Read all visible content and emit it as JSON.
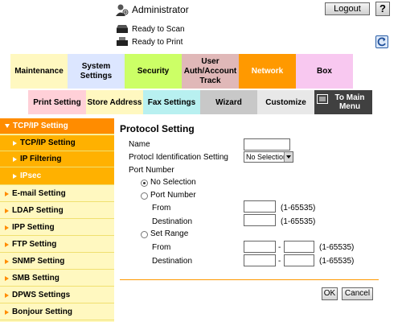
{
  "header": {
    "admin_label": "Administrator",
    "logout_label": "Logout",
    "help_label": "?",
    "status_scan": "Ready to Scan",
    "status_print": "Ready to Print"
  },
  "tabs_top": [
    {
      "label": "Maintenance",
      "bg": "#fff8c0"
    },
    {
      "label": "System Settings",
      "bg": "#dce6ff"
    },
    {
      "label": "Security",
      "bg": "#ccff66"
    },
    {
      "label": "User Auth/Account Track",
      "bg": "#e0b8b8"
    },
    {
      "label": "Network",
      "bg": "#ff9900",
      "active": true
    },
    {
      "label": "Box",
      "bg": "#f8c8f0"
    }
  ],
  "tabs_second": [
    {
      "label": "Print Setting",
      "bg": "#ffd0d8"
    },
    {
      "label": "Store Address",
      "bg": "#fff8c0"
    },
    {
      "label": "Fax Settings",
      "bg": "#b8f0f0"
    },
    {
      "label": "Wizard",
      "bg": "#c8c8c8"
    },
    {
      "label": "Customize",
      "bg": "#e8e8e8"
    },
    {
      "label": "To Main Menu",
      "bg": "#404040"
    }
  ],
  "sidebar": {
    "items": [
      {
        "label": "TCP/IP Setting"
      },
      {
        "label": "TCP/IP Setting"
      },
      {
        "label": "IP Filtering"
      },
      {
        "label": "IPsec"
      },
      {
        "label": "E-mail Setting"
      },
      {
        "label": "LDAP Setting"
      },
      {
        "label": "IPP Setting"
      },
      {
        "label": "FTP Setting"
      },
      {
        "label": "SNMP Setting"
      },
      {
        "label": "SMB Setting"
      },
      {
        "label": "DPWS Settings"
      },
      {
        "label": "Bonjour Setting"
      }
    ]
  },
  "form": {
    "title": "Protocol Setting",
    "name_label": "Name",
    "name_value": "",
    "protocol_id_label": "Protocl Identification Setting",
    "protocol_id_value": "No Selection",
    "port_number_label": "Port Number",
    "no_selection_label": "No Selection",
    "port_number_option": "Port Number",
    "from_label": "From",
    "destination_label": "Destination",
    "range_hint": "(1-65535)",
    "set_range_label": "Set Range",
    "range_sep": "-",
    "ok_label": "OK",
    "cancel_label": "Cancel"
  },
  "colors": {
    "sidebar_active": "#ff8c00",
    "sidebar_sub": "#ffb100",
    "sidebar_bg": "#fff8c0",
    "divider": "#ff9900"
  }
}
